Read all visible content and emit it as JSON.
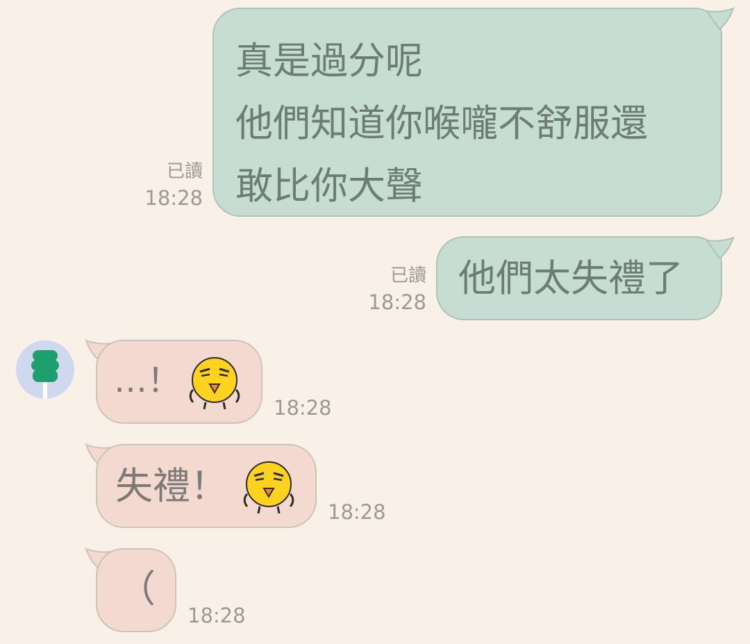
{
  "messages": [
    {
      "direction": "out",
      "lines": [
        "真是過分呢",
        "他們知道你喉嚨不舒服還",
        "敢比你大聲"
      ],
      "read_label": "已讀",
      "time": "18:28"
    },
    {
      "direction": "out",
      "lines": [
        "他們太失禮了"
      ],
      "read_label": "已讀",
      "time": "18:28"
    },
    {
      "direction": "in",
      "text": "…！",
      "sticker": "grumpy-yellow-face-emoji",
      "time": "18:28"
    },
    {
      "direction": "in",
      "text": "失禮！",
      "sticker": "grumpy-yellow-face-emoji",
      "time": "18:28"
    },
    {
      "direction": "in",
      "text": "（",
      "time": "18:28"
    }
  ],
  "colors": {
    "background": "#f9f0e7",
    "outgoing_bubble": "#c6ddd3",
    "incoming_bubble": "#f3d9cf",
    "avatar_bg": "#cfd8ee",
    "avatar_icon": "#1f9e6e",
    "timestamp": "#9b9994"
  },
  "icons": {
    "avatar": "green-totem-avatar-icon"
  }
}
